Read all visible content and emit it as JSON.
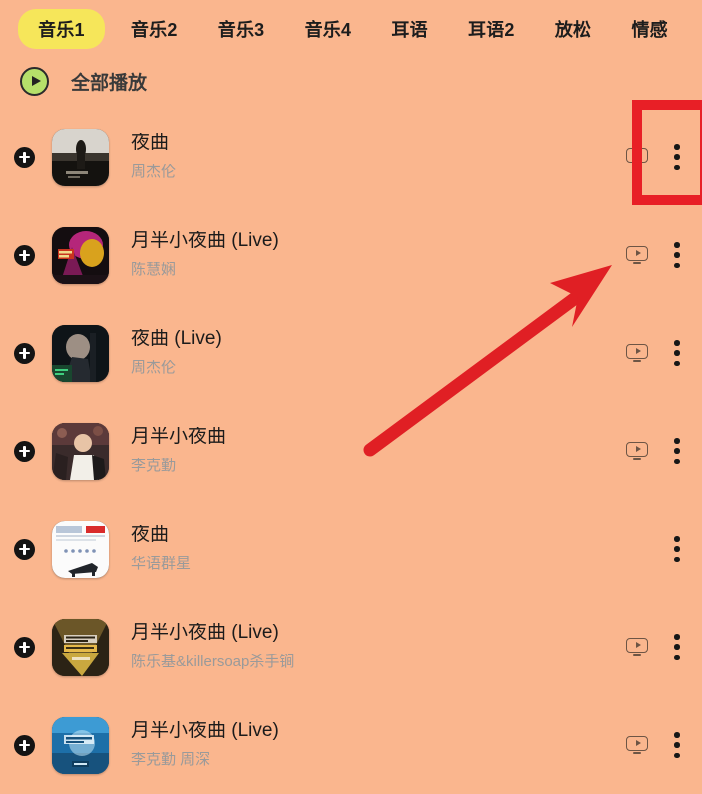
{
  "theme": {
    "background": "#fab68e",
    "active_tab_bg": "#f6e65a",
    "annotation_red": "#e81f26",
    "play_all_green": "#b6e06a",
    "title_color": "#1b1b1b",
    "artist_color": "#9a9a9a"
  },
  "tabs": [
    {
      "label": "音乐1",
      "active": true
    },
    {
      "label": "音乐2",
      "active": false
    },
    {
      "label": "音乐3",
      "active": false
    },
    {
      "label": "音乐4",
      "active": false
    },
    {
      "label": "耳语",
      "active": false
    },
    {
      "label": "耳语2",
      "active": false
    },
    {
      "label": "放松",
      "active": false
    },
    {
      "label": "情感",
      "active": false
    }
  ],
  "play_all": {
    "label": "全部播放",
    "icon": "play-circle-icon"
  },
  "songs": [
    {
      "title": "夜曲",
      "artist": "周杰伦",
      "has_mv": true,
      "add_icon": "plus-circle-icon",
      "menu_icon": "more-vertical-icon",
      "mv_icon": "mv-monitor-icon",
      "cover": "cover-night-figure"
    },
    {
      "title": "月半小夜曲 (Live)",
      "artist": "陈慧娴",
      "has_mv": true,
      "add_icon": "plus-circle-icon",
      "menu_icon": "more-vertical-icon",
      "mv_icon": "mv-monitor-icon",
      "cover": "cover-stage-magenta"
    },
    {
      "title": "夜曲 (Live)",
      "artist": "周杰伦",
      "has_mv": true,
      "add_icon": "plus-circle-icon",
      "menu_icon": "more-vertical-icon",
      "mv_icon": "mv-monitor-icon",
      "cover": "cover-concert-dark"
    },
    {
      "title": "月半小夜曲",
      "artist": "李克勤",
      "has_mv": true,
      "add_icon": "plus-circle-icon",
      "menu_icon": "more-vertical-icon",
      "mv_icon": "mv-monitor-icon",
      "cover": "cover-crowd-white"
    },
    {
      "title": "夜曲",
      "artist": "华语群星",
      "has_mv": false,
      "add_icon": "plus-circle-icon",
      "menu_icon": "more-vertical-icon",
      "mv_icon": "",
      "cover": "cover-white-piano"
    },
    {
      "title": "月半小夜曲 (Live)",
      "artist": "陈乐基&killersoap杀手锏",
      "has_mv": true,
      "add_icon": "plus-circle-icon",
      "menu_icon": "more-vertical-icon",
      "mv_icon": "mv-monitor-icon",
      "cover": "cover-gold-stage"
    },
    {
      "title": "月半小夜曲 (Live)",
      "artist": "李克勤 周深",
      "has_mv": true,
      "add_icon": "plus-circle-icon",
      "menu_icon": "more-vertical-icon",
      "mv_icon": "mv-monitor-icon",
      "cover": "cover-blue-stage"
    }
  ],
  "annotations": {
    "highlight_box": {
      "name": "red-highlight-box",
      "target": "more-vertical-icon of row 1"
    },
    "arrow": {
      "name": "red-arrow",
      "target": "mv-monitor-icon of row 2"
    }
  }
}
